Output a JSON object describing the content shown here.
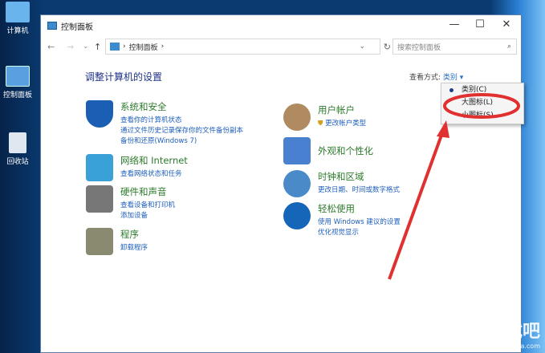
{
  "desktop": {
    "icons": [
      {
        "label": "计算机"
      },
      {
        "label": "控制面板"
      },
      {
        "label": "回收站"
      }
    ]
  },
  "window": {
    "title": "控制面板",
    "minimize": "—",
    "maximize": "☐",
    "close": "✕"
  },
  "nav": {
    "back": "←",
    "forward": "→",
    "recent": "⌄",
    "up": "↑",
    "breadcrumb": "控制面板",
    "sep": "›",
    "refresh": "↻",
    "dropdown": "⌄",
    "search_placeholder": "搜索控制面板",
    "search_icon": "⌕"
  },
  "heading": "调整计算机的设置",
  "view": {
    "label": "查看方式:",
    "value": "类别 ▾"
  },
  "menu": {
    "items": [
      "类别(C)",
      "大图标(L)",
      "小图标(S)"
    ],
    "selected": 0
  },
  "categories": [
    {
      "title": "系统和安全",
      "links": [
        "查看你的计算机状态",
        "通过文件历史记录保存你的文件备份副本",
        "备份和还原(Windows 7)"
      ],
      "color": "#1a5fb4"
    },
    {
      "title": "网络和 Internet",
      "links": [
        "查看网络状态和任务"
      ],
      "color": "#3aa0d8"
    },
    {
      "title": "硬件和声音",
      "links": [
        "查看设备和打印机",
        "添加设备"
      ],
      "color": "#777777"
    },
    {
      "title": "程序",
      "links": [
        "卸载程序"
      ],
      "color": "#8a8a70"
    },
    {
      "title": "用户帐户",
      "links": [
        "更改帐户类型"
      ],
      "color": "#b08a60"
    },
    {
      "title": "外观和个性化",
      "links": [],
      "color": "#4a80d0"
    },
    {
      "title": "时钟和区域",
      "links": [
        "更改日期、时间或数字格式"
      ],
      "color": "#4a8ac8"
    },
    {
      "title": "轻松使用",
      "links": [
        "使用 Windows 建议的设置",
        "优化视觉显示"
      ],
      "color": "#1565b8"
    }
  ],
  "annotation_color": "#e03030",
  "watermark": {
    "main": "下载吧",
    "sub": "www.xiazaiba.com"
  }
}
